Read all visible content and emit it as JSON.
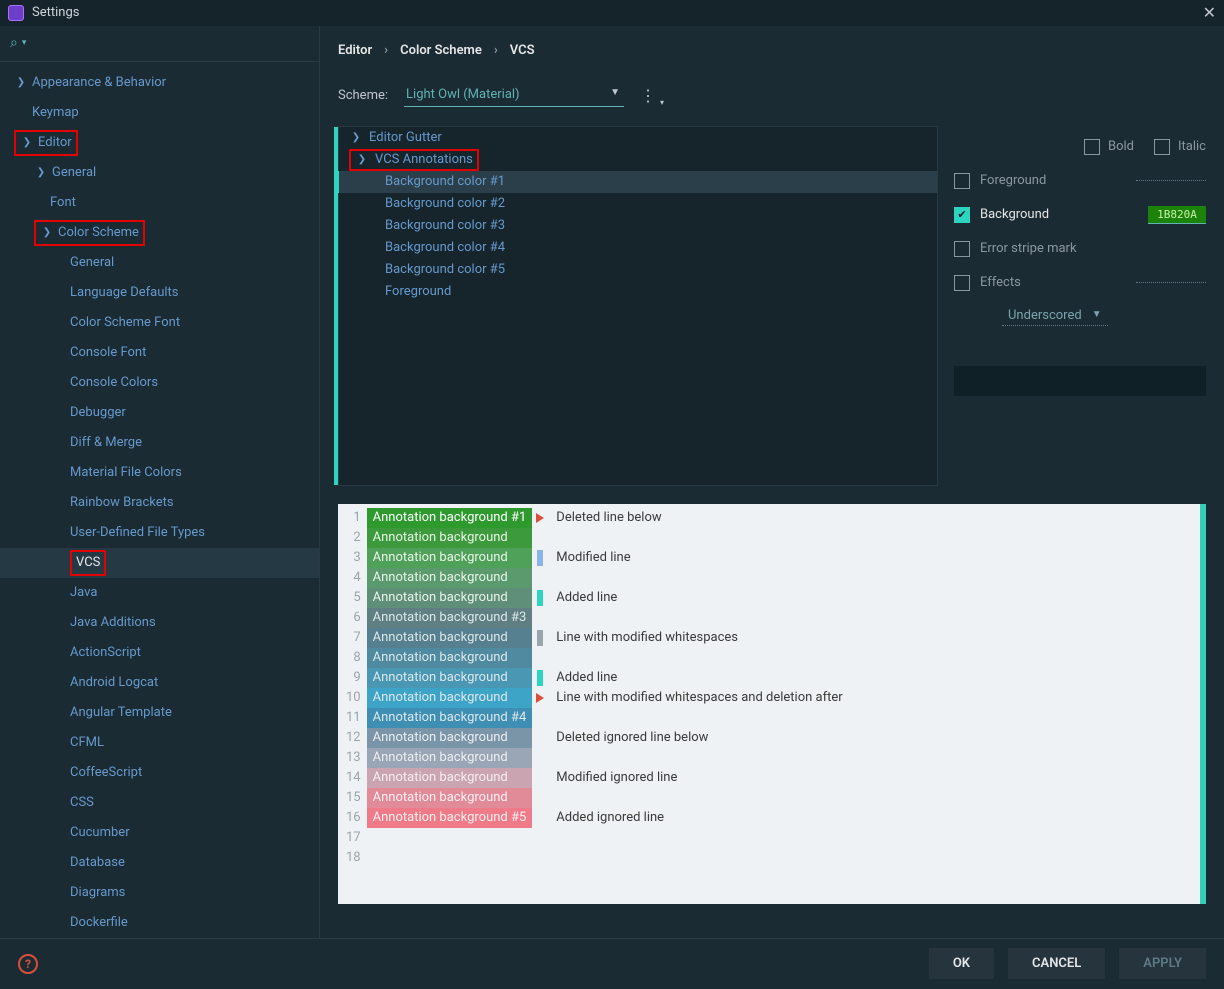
{
  "title": "Settings",
  "breadcrumb": [
    "Editor",
    "Color Scheme",
    "VCS"
  ],
  "scheme": {
    "label": "Scheme:",
    "value": "Light Owl (Material)"
  },
  "sidebar": {
    "items": [
      {
        "label": "Appearance & Behavior",
        "indent": 14,
        "exp": "❯",
        "hl": false
      },
      {
        "label": "Keymap",
        "indent": 32,
        "exp": "",
        "hl": false
      },
      {
        "label": "Editor",
        "indent": 14,
        "exp": "❯",
        "hl": true
      },
      {
        "label": "General",
        "indent": 34,
        "exp": "❯",
        "hl": false
      },
      {
        "label": "Font",
        "indent": 50,
        "exp": "",
        "hl": false
      },
      {
        "label": "Color Scheme",
        "indent": 34,
        "exp": "❯",
        "hl": true
      },
      {
        "label": "General",
        "indent": 70,
        "exp": "",
        "hl": false
      },
      {
        "label": "Language Defaults",
        "indent": 70,
        "exp": "",
        "hl": false
      },
      {
        "label": "Color Scheme Font",
        "indent": 70,
        "exp": "",
        "hl": false
      },
      {
        "label": "Console Font",
        "indent": 70,
        "exp": "",
        "hl": false
      },
      {
        "label": "Console Colors",
        "indent": 70,
        "exp": "",
        "hl": false
      },
      {
        "label": "Debugger",
        "indent": 70,
        "exp": "",
        "hl": false
      },
      {
        "label": "Diff & Merge",
        "indent": 70,
        "exp": "",
        "hl": false
      },
      {
        "label": "Material File Colors",
        "indent": 70,
        "exp": "",
        "hl": false
      },
      {
        "label": "Rainbow Brackets",
        "indent": 70,
        "exp": "",
        "hl": false
      },
      {
        "label": "User-Defined File Types",
        "indent": 70,
        "exp": "",
        "hl": false
      },
      {
        "label": "VCS",
        "indent": 70,
        "exp": "",
        "hl": true,
        "selected": true
      },
      {
        "label": "Java",
        "indent": 70,
        "exp": "",
        "hl": false
      },
      {
        "label": "Java Additions",
        "indent": 70,
        "exp": "",
        "hl": false
      },
      {
        "label": "ActionScript",
        "indent": 70,
        "exp": "",
        "hl": false
      },
      {
        "label": "Android Logcat",
        "indent": 70,
        "exp": "",
        "hl": false
      },
      {
        "label": "Angular Template",
        "indent": 70,
        "exp": "",
        "hl": false
      },
      {
        "label": "CFML",
        "indent": 70,
        "exp": "",
        "hl": false
      },
      {
        "label": "CoffeeScript",
        "indent": 70,
        "exp": "",
        "hl": false
      },
      {
        "label": "CSS",
        "indent": 70,
        "exp": "",
        "hl": false
      },
      {
        "label": "Cucumber",
        "indent": 70,
        "exp": "",
        "hl": false
      },
      {
        "label": "Database",
        "indent": 70,
        "exp": "",
        "hl": false
      },
      {
        "label": "Diagrams",
        "indent": 70,
        "exp": "",
        "hl": false
      },
      {
        "label": "Dockerfile",
        "indent": 70,
        "exp": "",
        "hl": false
      }
    ]
  },
  "attr_tree": [
    {
      "label": "Editor Gutter",
      "exp": "❯",
      "sub": false,
      "hl": false
    },
    {
      "label": "VCS Annotations",
      "exp": "❯",
      "sub": false,
      "hl": true
    },
    {
      "label": "Background color #1",
      "exp": "",
      "sub": true,
      "sel": true
    },
    {
      "label": "Background color #2",
      "exp": "",
      "sub": true
    },
    {
      "label": "Background color #3",
      "exp": "",
      "sub": true
    },
    {
      "label": "Background color #4",
      "exp": "",
      "sub": true
    },
    {
      "label": "Background color #5",
      "exp": "",
      "sub": true
    },
    {
      "label": "Foreground",
      "exp": "",
      "sub": true
    }
  ],
  "props": {
    "bold": "Bold",
    "italic": "Italic",
    "foreground": "Foreground",
    "background": "Background",
    "background_value": "1B820A",
    "error_stripe": "Error stripe mark",
    "effects": "Effects",
    "effects_type": "Underscored"
  },
  "preview": {
    "annotations": [
      {
        "text": "Annotation background #1",
        "bg": "#2e9a2e",
        "fg": "#ffffff"
      },
      {
        "text": "Annotation background",
        "bg": "#3c9a3c",
        "fg": "#e8f5e8"
      },
      {
        "text": "Annotation background",
        "bg": "#4fa15a",
        "fg": "#e8f5e8"
      },
      {
        "text": "Annotation background",
        "bg": "#5a9a6d",
        "fg": "#e8f5e8"
      },
      {
        "text": "Annotation background",
        "bg": "#5f8f78",
        "fg": "#e8f5e8"
      },
      {
        "text": "Annotation background #3",
        "bg": "#5f7f82",
        "fg": "#dce8ea"
      },
      {
        "text": "Annotation background",
        "bg": "#56808f",
        "fg": "#dce8ea"
      },
      {
        "text": "Annotation background",
        "bg": "#4f8aa0",
        "fg": "#dce8ea"
      },
      {
        "text": "Annotation background",
        "bg": "#4a97b4",
        "fg": "#dce8ea"
      },
      {
        "text": "Annotation background",
        "bg": "#3da4c8",
        "fg": "#dce8ea"
      },
      {
        "text": "Annotation background #4",
        "bg": "#3f8fb5",
        "fg": "#dce8ea"
      },
      {
        "text": "Annotation background",
        "bg": "#7a94a8",
        "fg": "#eceff1"
      },
      {
        "text": "Annotation background",
        "bg": "#9aa5b5",
        "fg": "#eceff1"
      },
      {
        "text": "Annotation background",
        "bg": "#caa4b1",
        "fg": "#f5eff1"
      },
      {
        "text": "Annotation background",
        "bg": "#e18a98",
        "fg": "#fff0f2"
      },
      {
        "text": "Annotation background #5",
        "bg": "#ef7a88",
        "fg": "#fff0f2"
      }
    ],
    "lines": [
      {
        "mark": "del",
        "text": "Deleted line below"
      },
      {
        "mark": "",
        "text": ""
      },
      {
        "mark": "mod",
        "text": "Modified line"
      },
      {
        "mark": "",
        "text": ""
      },
      {
        "mark": "add",
        "text": "Added line"
      },
      {
        "mark": "",
        "text": ""
      },
      {
        "mark": "ws",
        "text": "Line with modified whitespaces"
      },
      {
        "mark": "",
        "text": ""
      },
      {
        "mark": "add",
        "text": "Added line"
      },
      {
        "mark": "del",
        "text": "Line with modified whitespaces and deletion after"
      },
      {
        "mark": "",
        "text": ""
      },
      {
        "mark": "",
        "text": "Deleted ignored line below"
      },
      {
        "mark": "",
        "text": ""
      },
      {
        "mark": "",
        "text": "Modified ignored line"
      },
      {
        "mark": "",
        "text": ""
      },
      {
        "mark": "",
        "text": "Added ignored line"
      },
      {
        "mark": "",
        "text": ""
      },
      {
        "mark": "",
        "text": ""
      }
    ]
  },
  "footer": {
    "ok": "OK",
    "cancel": "CANCEL",
    "apply": "APPLY"
  }
}
